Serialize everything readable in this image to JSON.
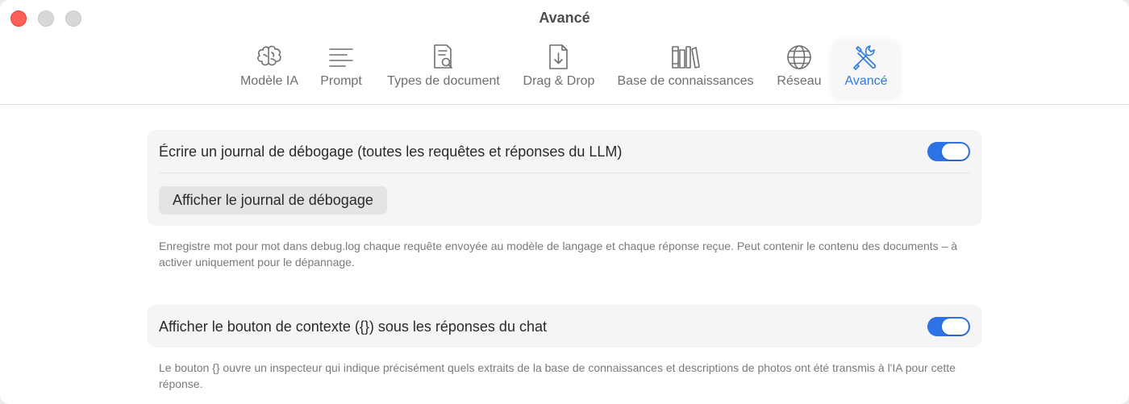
{
  "window": {
    "title": "Avancé"
  },
  "tabs": [
    {
      "label": "Modèle IA",
      "icon": "brain-icon"
    },
    {
      "label": "Prompt",
      "icon": "text-lines-icon"
    },
    {
      "label": "Types de document",
      "icon": "document-search-icon"
    },
    {
      "label": "Drag & Drop",
      "icon": "document-download-icon"
    },
    {
      "label": "Base de connaissances",
      "icon": "books-icon"
    },
    {
      "label": "Réseau",
      "icon": "globe-icon"
    },
    {
      "label": "Avancé",
      "icon": "tools-icon",
      "active": true
    }
  ],
  "debug": {
    "toggle_label": "Écrire un journal de débogage (toutes les requêtes et réponses du LLM)",
    "toggle_on": true,
    "button_label": "Afficher le journal de débogage",
    "note": "Enregistre mot pour mot dans debug.log chaque requête envoyée au modèle de langage et chaque réponse reçue. Peut contenir le contenu des documents – à activer uniquement pour le dépannage."
  },
  "context": {
    "toggle_label": "Afficher le bouton de contexte ({}) sous les réponses du chat",
    "toggle_on": true,
    "note": "Le bouton {} ouvre un inspecteur qui indique précisément quels extraits de la base de connaissances et descriptions de photos ont été transmis à l'IA pour cette réponse."
  },
  "colors": {
    "accent": "#2f7ae5",
    "toggle_on": "#2e73e6",
    "close": "#fe5f57"
  }
}
